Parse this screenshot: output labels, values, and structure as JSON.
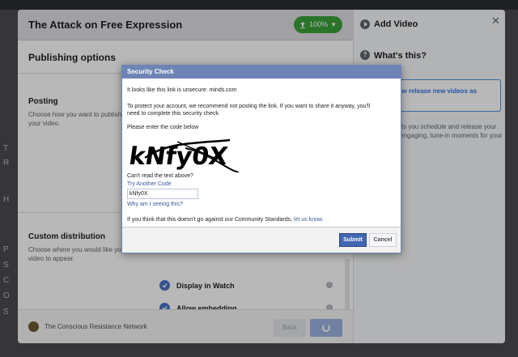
{
  "background": {
    "top_text": "",
    "left_letters": [
      "T",
      "R",
      "H",
      "P",
      "S",
      "C",
      "O",
      "S"
    ]
  },
  "main_dialog": {
    "title": "The Attack on Free Expression",
    "upload_progress": "100%",
    "upload_percent": 100,
    "sections": {
      "publishing_options": "Publishing options",
      "posting_title": "Posting",
      "posting_desc": "Choose how you want to publish your video.",
      "custom_title": "Custom distribution",
      "custom_desc": "Choose where you would like your video to appear."
    },
    "options": [
      {
        "label": "Display in Watch",
        "checked": true
      },
      {
        "label": "Allow embedding",
        "checked": true
      }
    ],
    "footer": {
      "network_name": "The Conscious Resistance Network",
      "back_label": "Back"
    }
  },
  "right_panel": {
    "title": "Add Video",
    "whats_this": "What's this?",
    "premiere_text": "You can now release new videos as premieres.",
    "premiere_desc": "Premieres lets you schedule and release your video as an engaging, tune-in moments for your audience."
  },
  "security_check": {
    "title": "Security Check",
    "unsecure_line": "It looks like this link is unsecure: minds.com",
    "protect_line1": "To protect your account, we recommend not posting the link. If you want to share it anyway, you'll",
    "protect_line2": "need to complete this security check.",
    "enter_code": "Please enter the code below",
    "captcha_text": "kNfy0X",
    "cant_read": "Can't read the text above?",
    "try_another": "Try Another Code",
    "input_value": "kNfy0X",
    "why_seeing": "Why am I seeing this?",
    "standards_text": "If you think that this doesn't go against our Community Standards,",
    "let_us_know": "let us know.",
    "submit_label": "Submit",
    "cancel_label": "Cancel"
  },
  "colors": {
    "accent": "#4267b2",
    "progress_green": "#3aa13a",
    "dialog_header": "#6d84b4"
  }
}
